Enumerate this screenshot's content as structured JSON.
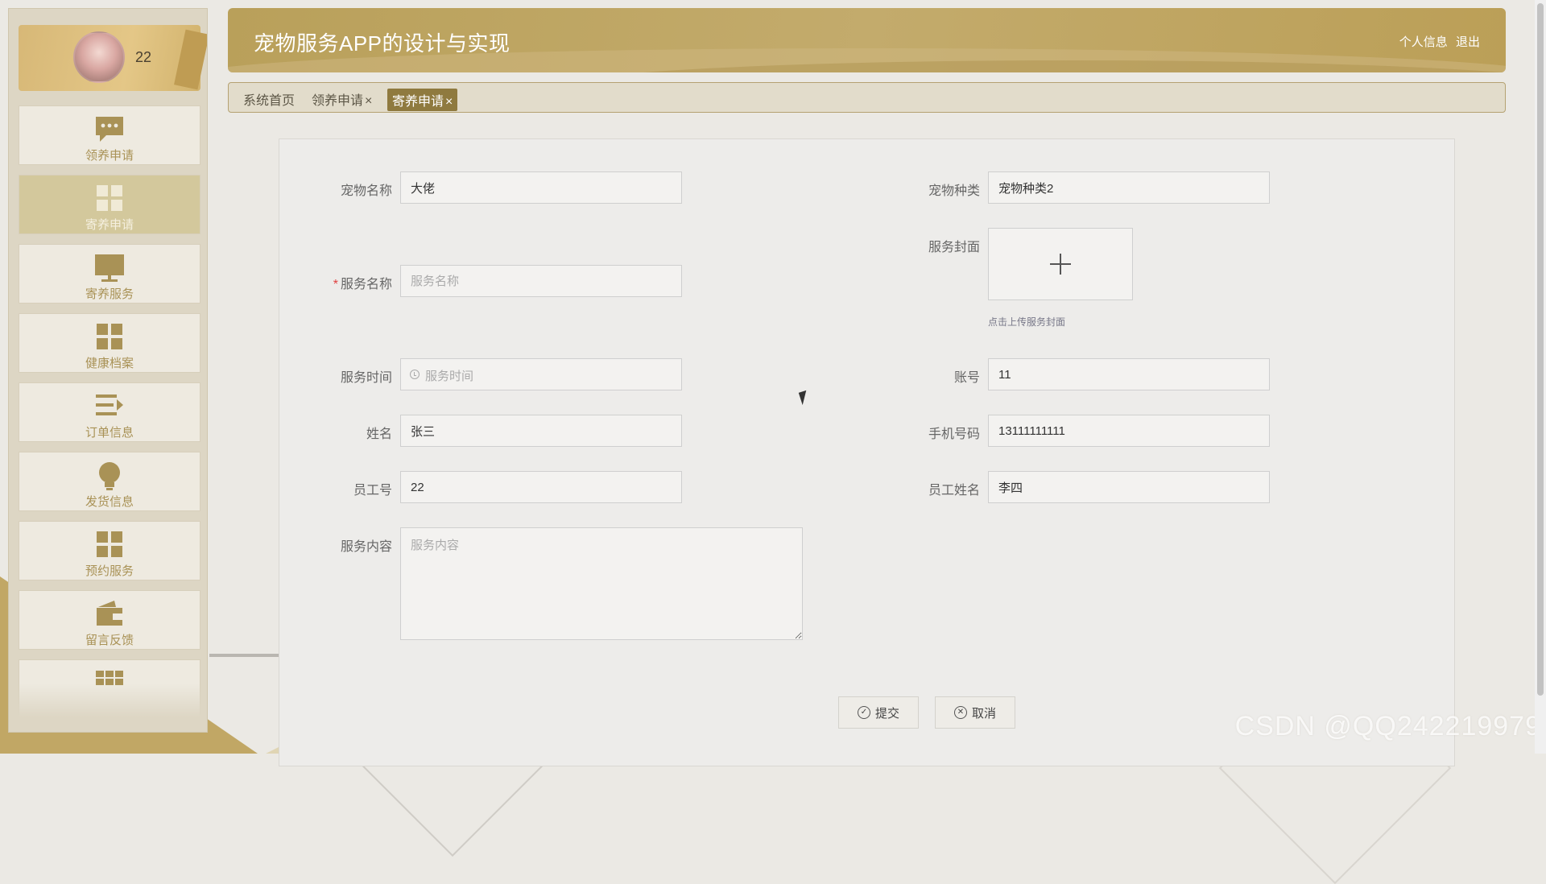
{
  "header": {
    "title": "宠物服务APP的设计与实现",
    "profile_link": "个人信息",
    "logout_link": "退出"
  },
  "user": {
    "name": "22"
  },
  "sidebar": {
    "items": [
      {
        "label": "领养申请",
        "icon": "chat-bubble-icon",
        "active": false
      },
      {
        "label": "寄养申请",
        "icon": "grid-icon",
        "active": true
      },
      {
        "label": "寄养服务",
        "icon": "monitor-icon",
        "active": false
      },
      {
        "label": "健康档案",
        "icon": "grid-icon",
        "active": false
      },
      {
        "label": "订单信息",
        "icon": "list-arrow-icon",
        "active": false
      },
      {
        "label": "发货信息",
        "icon": "lightbulb-icon",
        "active": false
      },
      {
        "label": "预约服务",
        "icon": "grid-icon",
        "active": false
      },
      {
        "label": "留言反馈",
        "icon": "wallet-icon",
        "active": false
      },
      {
        "label": "",
        "icon": "table-icon",
        "active": false
      }
    ]
  },
  "tabs": {
    "home": "系统首页",
    "adopt": "领养申请",
    "foster": "寄养申请",
    "close": "×"
  },
  "form": {
    "pet_name": {
      "label": "宠物名称",
      "value": "大佬"
    },
    "pet_type": {
      "label": "宠物种类",
      "value": "宠物种类2"
    },
    "service_name": {
      "label": "服务名称",
      "placeholder": "服务名称",
      "required": "*"
    },
    "service_cover": {
      "label": "服务封面",
      "hint": "点击上传服务封面"
    },
    "service_time": {
      "label": "服务时间",
      "placeholder": "服务时间"
    },
    "account": {
      "label": "账号",
      "value": "11"
    },
    "name": {
      "label": "姓名",
      "value": "张三"
    },
    "phone": {
      "label": "手机号码",
      "value": "13111111111"
    },
    "staff_no": {
      "label": "员工号",
      "value": "22"
    },
    "staff_name": {
      "label": "员工姓名",
      "value": "李四"
    },
    "service_content": {
      "label": "服务内容",
      "placeholder": "服务内容"
    },
    "submit": "提交",
    "cancel": "取消"
  },
  "watermark": "CSDN @QQ242219979",
  "colors": {
    "accent": "#b9a05a",
    "active_tab": "#8f7a3f",
    "sidebar_label": "#a99256"
  }
}
